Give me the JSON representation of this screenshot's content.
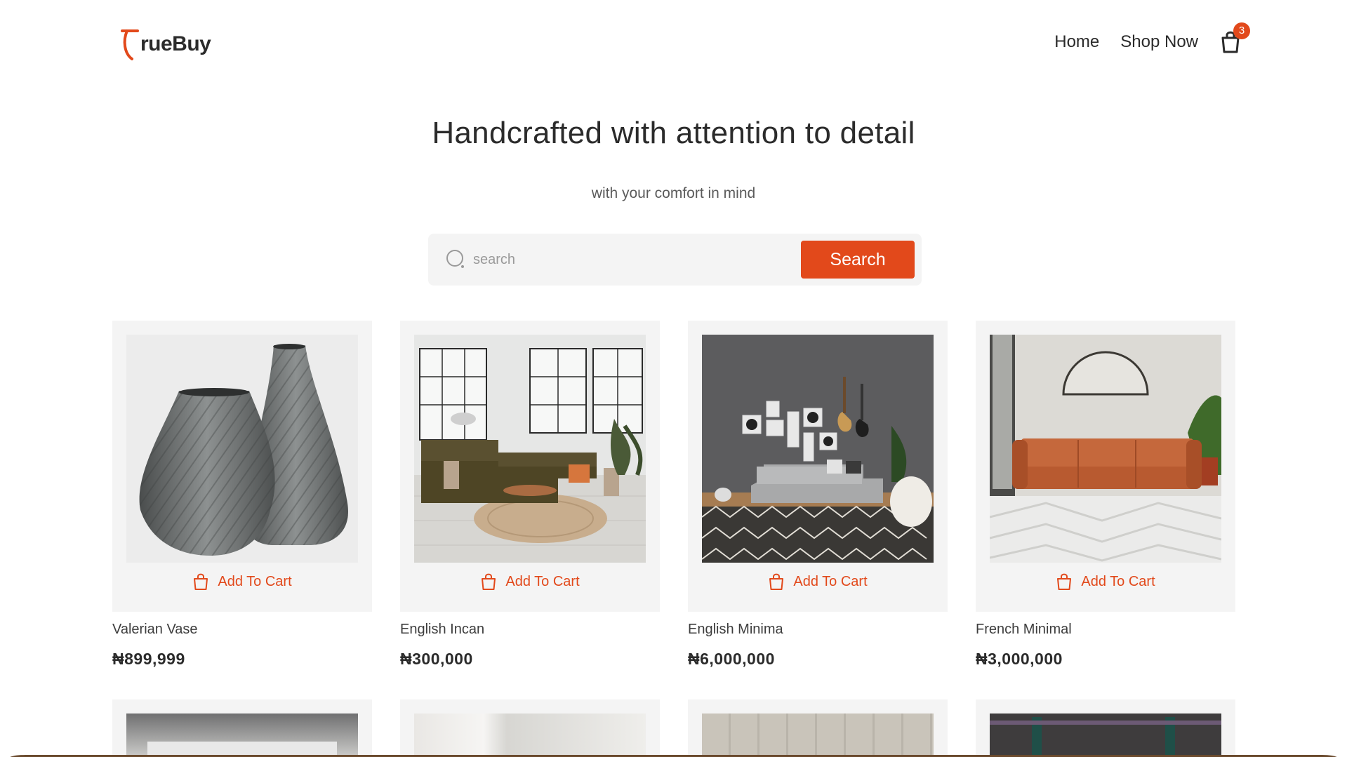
{
  "brand": {
    "logo_text": "rueBuy",
    "logo_letter": "T",
    "accent": "#e2491b"
  },
  "nav": {
    "home": "Home",
    "shop_now": "Shop Now",
    "cart_count": "3"
  },
  "hero": {
    "title": "Handcrafted with attention to detail",
    "subtitle": "with your comfort in mind"
  },
  "search": {
    "placeholder": "search",
    "value": "",
    "button": "Search"
  },
  "products": [
    {
      "name": "Valerian Vase",
      "price": "₦899,999",
      "cta": "Add To Cart"
    },
    {
      "name": "English Incan",
      "price": "₦300,000",
      "cta": "Add To Cart"
    },
    {
      "name": "English Minima",
      "price": "₦6,000,000",
      "cta": "Add To Cart"
    },
    {
      "name": "French Minimal",
      "price": "₦3,000,000",
      "cta": "Add To Cart"
    }
  ]
}
